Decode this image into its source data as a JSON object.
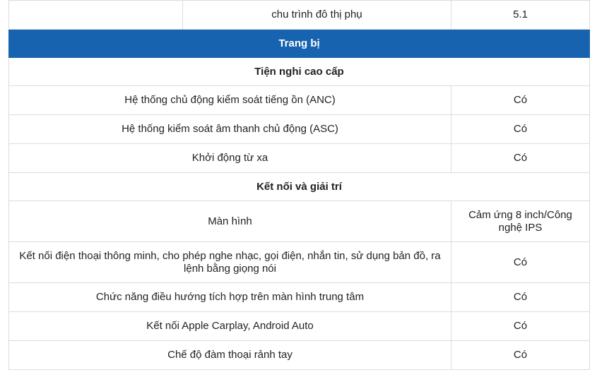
{
  "top_row": {
    "label": "chu trình đô thị phụ",
    "value": "5.1"
  },
  "header": {
    "title": "Trang bị"
  },
  "sections": [
    {
      "title": "Tiện nghi cao cấp",
      "rows": [
        {
          "label": "Hệ thống chủ động kiểm soát tiếng ồn (ANC)",
          "value": "Có"
        },
        {
          "label": "Hệ thống kiểm soát âm thanh chủ động (ASC)",
          "value": "Có"
        },
        {
          "label": "Khởi động từ xa",
          "value": "Có"
        }
      ]
    },
    {
      "title": "Kết nối và giải trí",
      "rows": [
        {
          "label": "Màn hình",
          "value": "Cảm ứng 8 inch/Công nghệ IPS"
        },
        {
          "label": "Kết nối điện thoại thông minh, cho phép nghe nhạc, gọi điện, nhắn tin, sử dụng bản đồ, ra lệnh bằng giọng nói",
          "value": "Có"
        },
        {
          "label": "Chức năng điều hướng tích hợp trên màn hình trung tâm",
          "value": "Có"
        },
        {
          "label": "Kết nối Apple Carplay, Android Auto",
          "value": "Có"
        },
        {
          "label": "Chế độ đàm thoại rảnh tay",
          "value": "Có"
        }
      ]
    }
  ],
  "colors": {
    "header_bg": "#1763b0",
    "border": "#dcdcdc"
  }
}
